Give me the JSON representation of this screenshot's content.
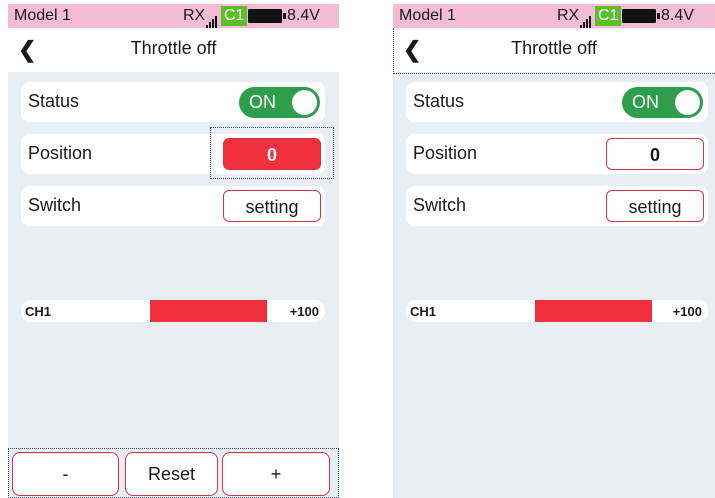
{
  "screens": [
    {
      "status_bar": {
        "model": "Model 1",
        "rx": "RX",
        "channel_badge": "C1",
        "voltage": "8.4V"
      },
      "header": {
        "back_icon": "chevron-left-icon",
        "title": "Throttle off"
      },
      "rows": {
        "status": {
          "label": "Status",
          "toggle": "ON"
        },
        "position": {
          "label": "Position",
          "value": "0"
        },
        "switch": {
          "label": "Switch",
          "button": "setting"
        }
      },
      "channel": {
        "name": "CH1",
        "value": "+100"
      },
      "bottom": {
        "minus": "-",
        "reset": "Reset",
        "plus": "+"
      }
    },
    {
      "status_bar": {
        "model": "Model 1",
        "rx": "RX",
        "channel_badge": "C1",
        "voltage": "8.4V"
      },
      "header": {
        "back_icon": "chevron-left-icon",
        "title": "Throttle off"
      },
      "rows": {
        "status": {
          "label": "Status",
          "toggle": "ON"
        },
        "position": {
          "label": "Position",
          "value": "0"
        },
        "switch": {
          "label": "Switch",
          "button": "setting"
        }
      },
      "channel": {
        "name": "CH1",
        "value": "+100"
      }
    }
  ],
  "colors": {
    "status_bar": "#f1bcd4",
    "accent_red": "#f0313d",
    "toggle_green": "#2e9e4c",
    "channel_badge_green": "#5cbf2a",
    "panel_bg": "#e9eef5",
    "highlight_dotted": "#2c4a9c"
  }
}
